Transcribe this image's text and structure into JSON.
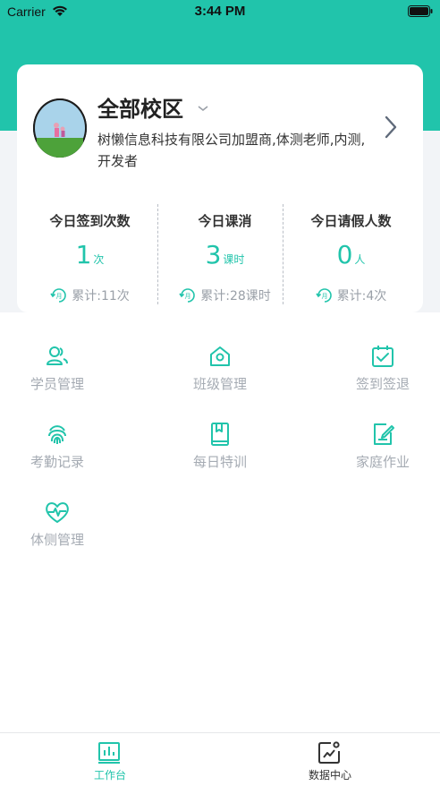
{
  "status_bar": {
    "carrier": "Carrier",
    "time": "3:44 PM"
  },
  "header": {
    "campus_title": "全部校区",
    "org_description": "树懒信息科技有限公司加盟商,体测老师,内测,开发者"
  },
  "stats": [
    {
      "label": "今日签到次数",
      "value": "1",
      "unit": "次",
      "total": "累计:11次"
    },
    {
      "label": "今日课消",
      "value": "3",
      "unit": "课时",
      "total": "累计:28课时"
    },
    {
      "label": "今日请假人数",
      "value": "0",
      "unit": "人",
      "total": "累计:4次"
    }
  ],
  "menu": [
    {
      "label": "学员管理",
      "icon": "users-icon"
    },
    {
      "label": "班级管理",
      "icon": "home-icon"
    },
    {
      "label": "签到签退",
      "icon": "calendar-check-icon"
    },
    {
      "label": "考勤记录",
      "icon": "fingerprint-icon"
    },
    {
      "label": "每日特训",
      "icon": "book-icon"
    },
    {
      "label": "家庭作业",
      "icon": "edit-document-icon"
    },
    {
      "label": "体侧管理",
      "icon": "heart-pulse-icon"
    }
  ],
  "tabs": [
    {
      "label": "工作台",
      "icon": "bar-chart-icon",
      "active": true
    },
    {
      "label": "数据中心",
      "icon": "trend-chart-icon",
      "active": false
    }
  ],
  "colors": {
    "accent": "#21c4ab",
    "muted": "#a5abb3",
    "background_band": "#f2f4f7"
  }
}
